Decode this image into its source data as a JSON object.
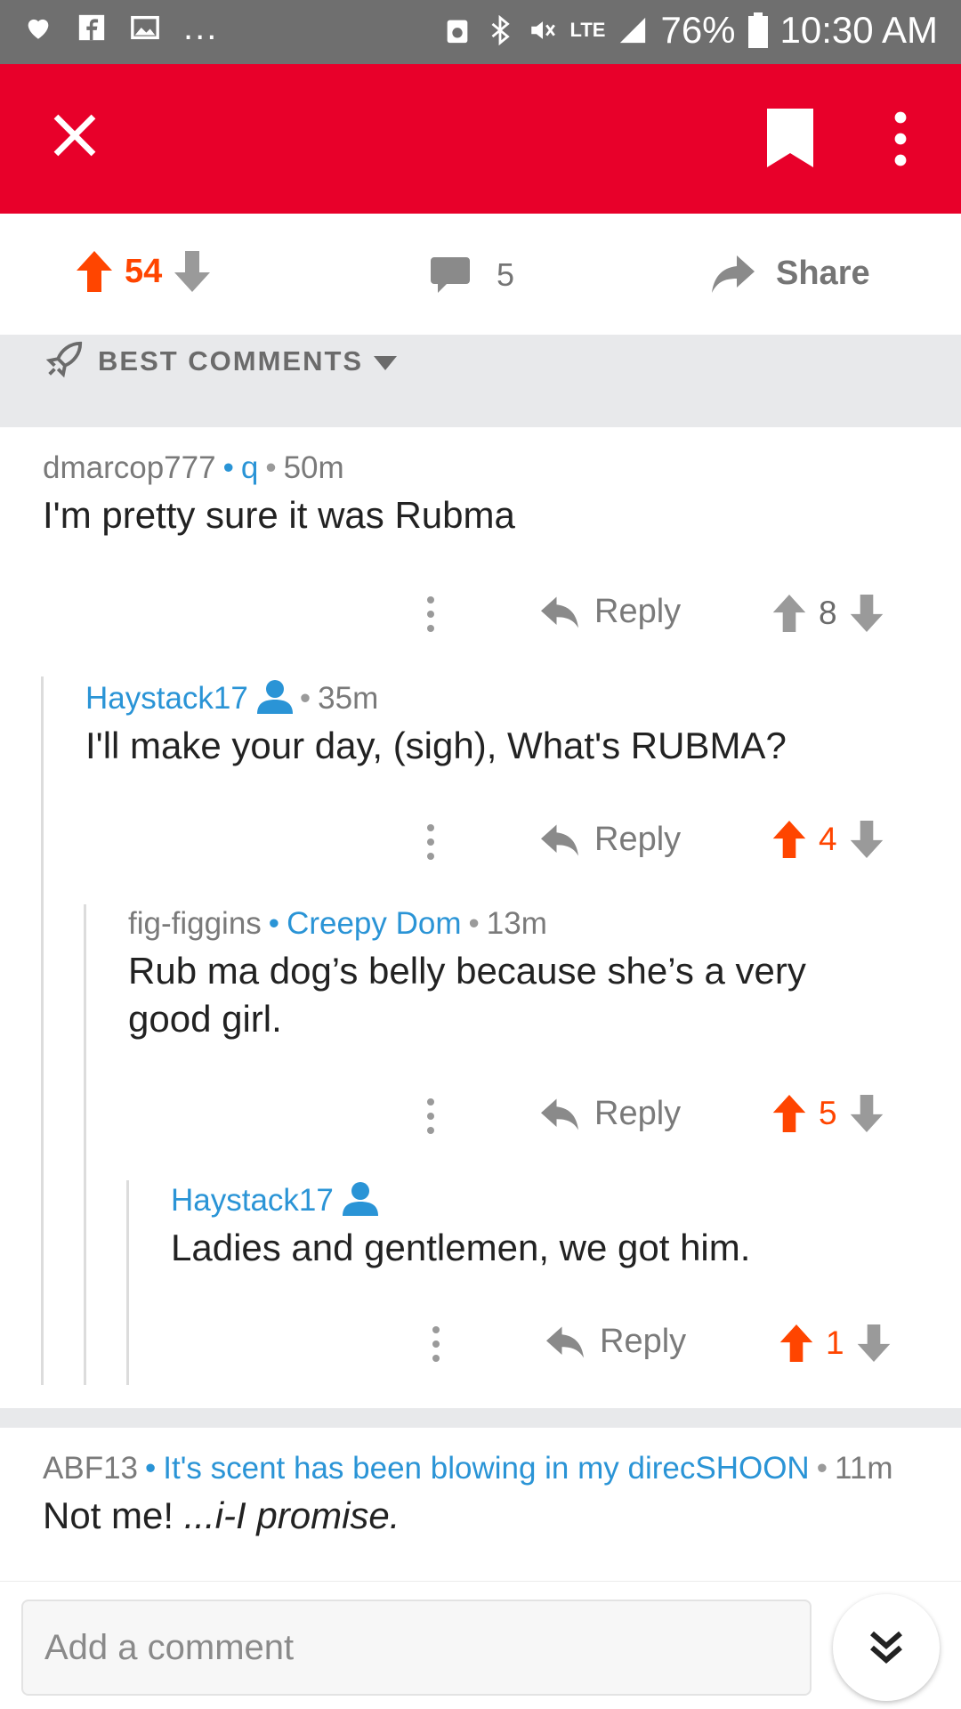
{
  "status_bar": {
    "battery": "76%",
    "time": "10:30 AM",
    "network": "LTE",
    "overflow": "..."
  },
  "post_actions": {
    "score": "54",
    "comment_count": "5",
    "share_label": "Share"
  },
  "sort": {
    "label": "BEST COMMENTS"
  },
  "comments": [
    {
      "user": "dmarcop777",
      "flair": "q",
      "age": "50m",
      "body": "I'm pretty sure it was Rubma",
      "reply_label": "Reply",
      "score": "8",
      "upvoted": false
    },
    {
      "user": "Haystack17",
      "age": "35m",
      "body": "I'll make your day, (sigh), What's RUBMA?",
      "reply_label": "Reply",
      "score": "4",
      "upvoted": true
    },
    {
      "user": "fig-figgins",
      "flair": "Creepy Dom",
      "age": "13m",
      "body_line1": "Rub ma dog’s belly because she’s a very",
      "body_line2": "good girl.",
      "reply_label": "Reply",
      "score": "5",
      "upvoted": true
    },
    {
      "user": "Haystack17",
      "body": "Ladies and gentlemen, we got him.",
      "reply_label": "Reply",
      "score": "1",
      "upvoted": true
    },
    {
      "user": "ABF13",
      "flair": "It's scent has been blowing in my direcSHOON",
      "age": "11m",
      "body_plain": "Not me! ",
      "body_italic": "...i-I promise."
    }
  ],
  "composer": {
    "placeholder": "Add a comment"
  },
  "colors": {
    "brand_red": "#e8002a",
    "upvote_orange": "#ff4500",
    "link_blue": "#2a94d6",
    "status_gray": "#6f6f6f"
  }
}
